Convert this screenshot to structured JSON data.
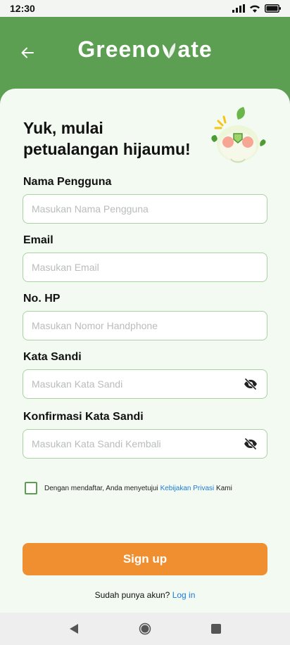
{
  "status_bar": {
    "time": "12:30"
  },
  "header": {
    "title_before": "Greeno",
    "title_after": "ate"
  },
  "form": {
    "headline_line1": "Yuk, mulai",
    "headline_line2": "petualangan hijaumu!",
    "fields": [
      {
        "label": "Nama Pengguna",
        "placeholder": "Masukan Nama Pengguna"
      },
      {
        "label": "Email",
        "placeholder": "Masukan Email"
      },
      {
        "label": "No. HP",
        "placeholder": "Masukan Nomor Handphone"
      },
      {
        "label": "Kata Sandi",
        "placeholder": "Masukan Kata Sandi"
      },
      {
        "label": "Konfirmasi Kata Sandi",
        "placeholder": "Masukan Kata Sandi Kembali"
      }
    ],
    "agree_prefix": "Dengan mendaftar, Anda menyetujui ",
    "agree_link": "Kebijakan Privasi",
    "agree_suffix": " Kami",
    "signup_label": "Sign up",
    "login_prompt": "Sudah punya akun? ",
    "login_link": "Log in"
  },
  "colors": {
    "brand_green": "#5c9e52",
    "card_bg": "#f2faf1",
    "accent_orange": "#f08f30",
    "link_blue": "#1e7bd6"
  }
}
